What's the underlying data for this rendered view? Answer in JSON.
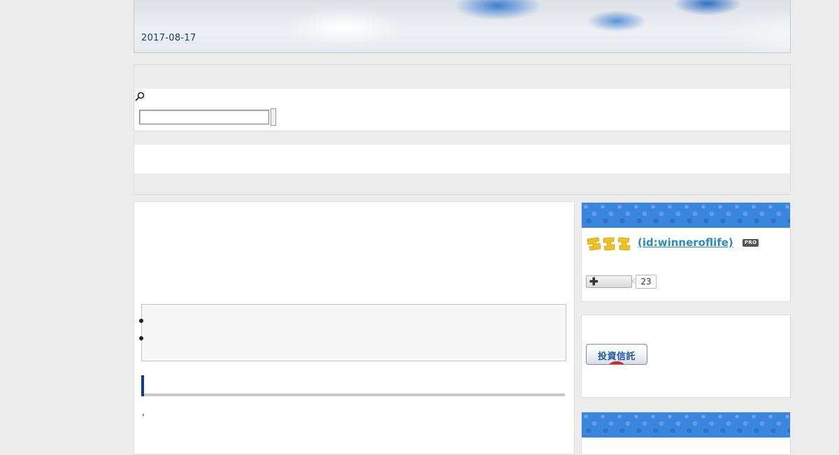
{
  "header": {
    "date": "2017-08-17"
  },
  "search": {
    "input_value": "",
    "placeholder": "",
    "button_label": ""
  },
  "article": {
    "toc_items": [
      "",
      ""
    ],
    "heading": "",
    "body_text": ","
  },
  "sidebar": {
    "profile": {
      "name": "(id:winneroflife)",
      "badge": "PRO",
      "follow_icon": "plus-icon",
      "follower_count": "23"
    },
    "fund_banner": {
      "label": "投資信託"
    }
  },
  "colors": {
    "page_bg": "#ececec",
    "accent_blue": "#0f3f8c",
    "link_blue": "#2a8ac0",
    "sidebar_header_blue": "#3a86df"
  }
}
